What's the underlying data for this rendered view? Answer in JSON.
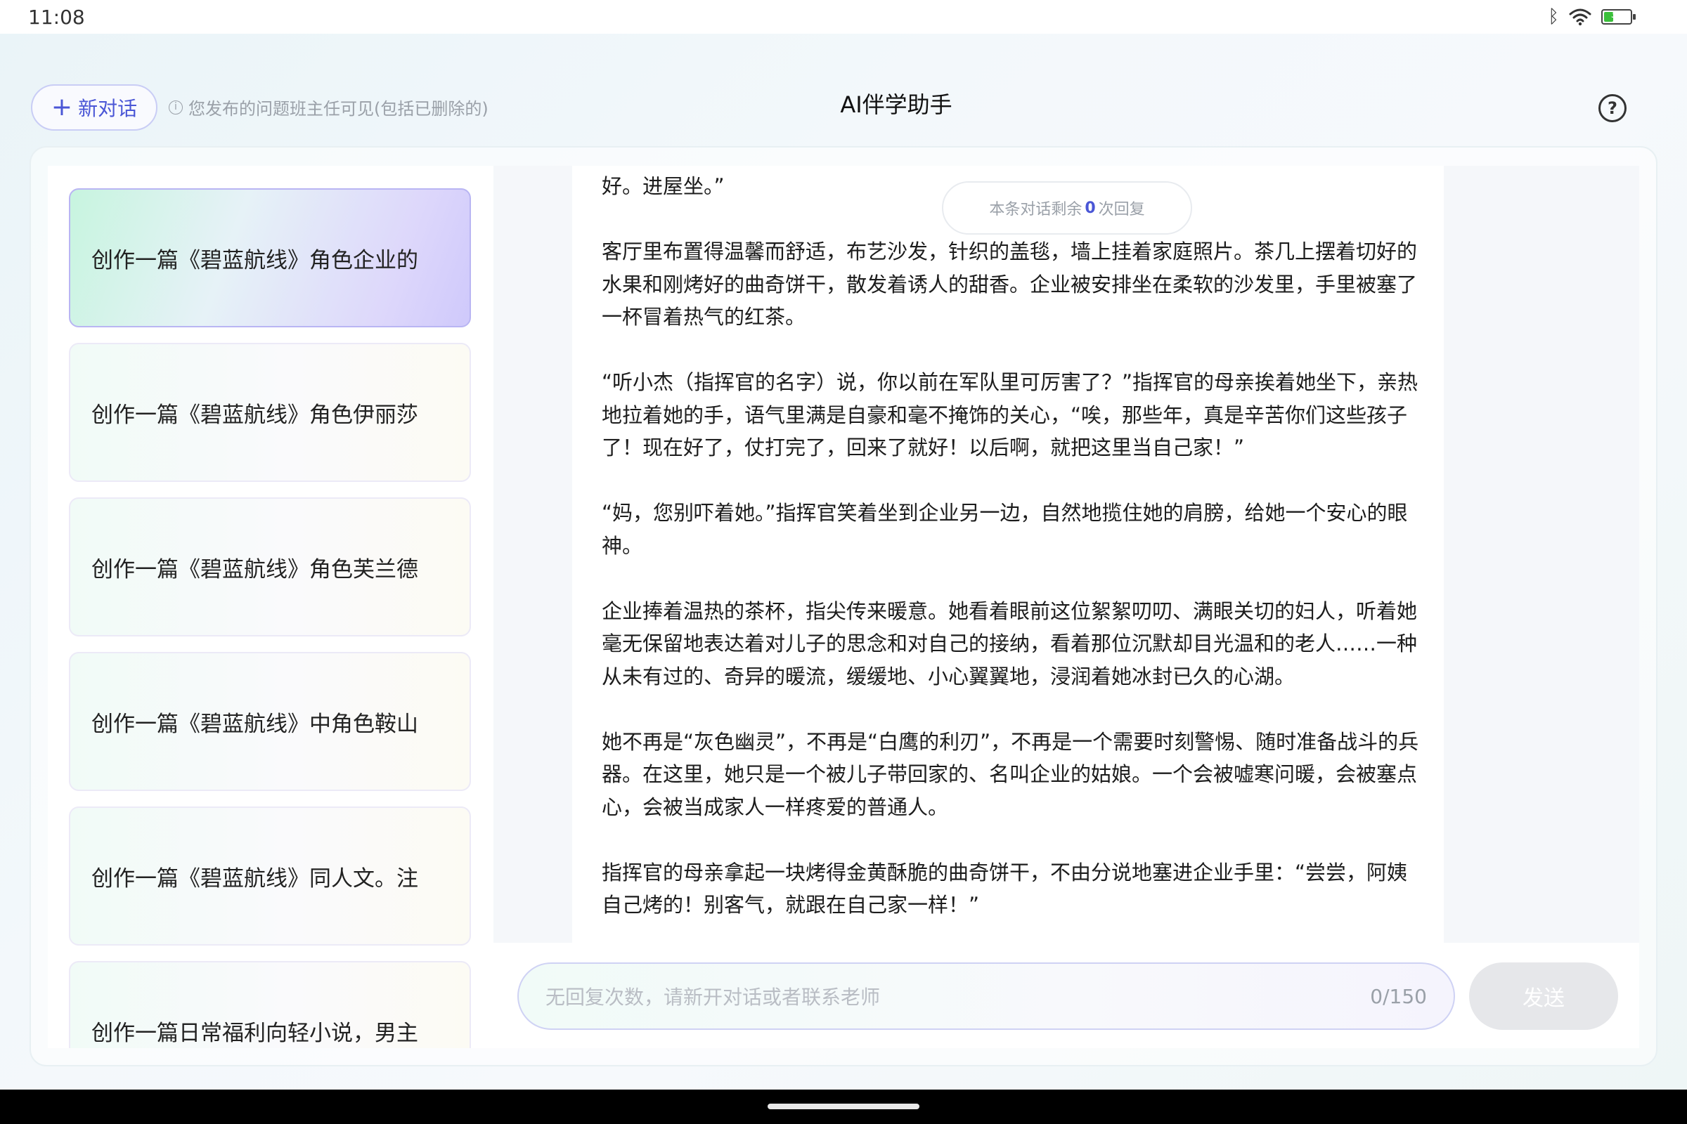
{
  "status_bar": {
    "time": "11:08",
    "bluetooth_icon": "bluetooth-icon",
    "wifi_icon": "wifi-icon",
    "battery_level": "37",
    "battery_fraction": 0.37
  },
  "header": {
    "new_chat_label": "新对话",
    "new_chat_icon": "plus-icon",
    "notice_icon": "info-icon",
    "notice": "您发布的问题班主任可见(包括已删除的)",
    "title": "AI伴学助手",
    "help_icon": "help-icon"
  },
  "sidebar": {
    "items": [
      {
        "label": "创作一篇《碧蓝航线》角色企业的",
        "active": true
      },
      {
        "label": "创作一篇《碧蓝航线》角色伊丽莎",
        "active": false
      },
      {
        "label": "创作一篇《碧蓝航线》角色芙兰德",
        "active": false
      },
      {
        "label": "创作一篇《碧蓝航线》中角色鞍山",
        "active": false
      },
      {
        "label": "创作一篇《碧蓝航线》同人文。注",
        "active": false
      },
      {
        "label": "创作一篇日常福利向轻小说，男主",
        "active": false
      }
    ]
  },
  "chat": {
    "remaining_prefix": "本条对话剩余",
    "remaining_count": "0",
    "remaining_suffix": "次回复",
    "paragraphs": [
      "好。进屋坐。”",
      "客厅里布置得温馨而舒适，布艺沙发，针织的盖毯，墙上挂着家庭照片。茶几上摆着切好的水果和刚烤好的曲奇饼干，散发着诱人的甜香。企业被安排坐在柔软的沙发里，手里被塞了一杯冒着热气的红茶。",
      "“听小杰（指挥官的名字）说，你以前在军队里可厉害了？”指挥官的母亲挨着她坐下，亲热地拉着她的手，语气里满是自豪和毫不掩饰的关心，“唉，那些年，真是辛苦你们这些孩子了！现在好了，仗打完了，回来了就好！以后啊，就把这里当自己家！”",
      "“妈，您别吓着她。”指挥官笑着坐到企业另一边，自然地揽住她的肩膀，给她一个安心的眼神。",
      "企业捧着温热的茶杯，指尖传来暖意。她看着眼前这位絮絮叨叨、满眼关切的妇人，听着她毫无保留地表达着对儿子的思念和对自己的接纳，看着那位沉默却目光温和的老人……一种从未有过的、奇异的暖流，缓缓地、小心翼翼地，浸润着她冰封已久的心湖。",
      "她不再是“灰色幽灵”，不再是“白鹰的利刃”，不再是一个需要时刻警惕、随时准备战斗的兵器。在这里，她只是一个被儿子带回家的、名叫企业的姑娘。一个会被嘘寒问暖，会被塞点心，会被当成家人一样疼爱的普通人。",
      "指挥官的母亲拿起一块烤得金黄酥脆的曲奇饼干，不由分说地塞进企业手里：“尝尝，阿姨自己烤的！别客气，就跟在自己家一样！”"
    ]
  },
  "input": {
    "placeholder": "无回复次数，请新开对话或者联系老师",
    "counter": "0/150",
    "send_label": "发送"
  },
  "colors": {
    "accent": "#4a56d6",
    "active_border": "#b9b5f3",
    "muted_text": "#9aa0a8"
  }
}
